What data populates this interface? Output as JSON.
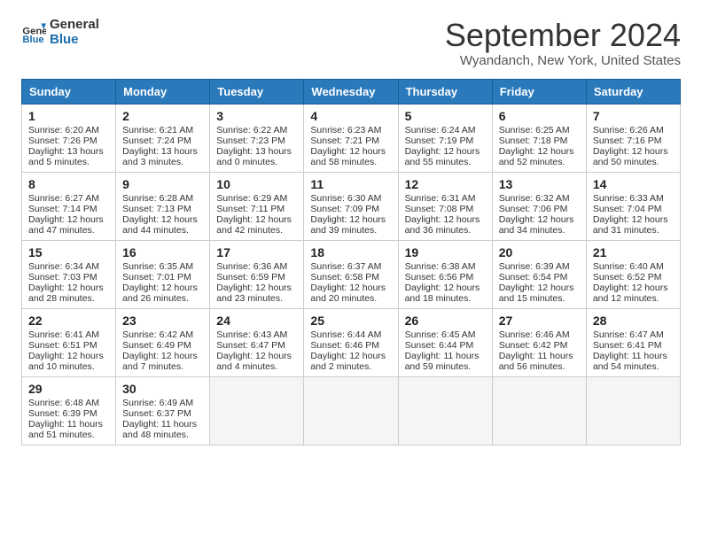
{
  "logo": {
    "line1": "General",
    "line2": "Blue"
  },
  "title": "September 2024",
  "location": "Wyandanch, New York, United States",
  "days_of_week": [
    "Sunday",
    "Monday",
    "Tuesday",
    "Wednesday",
    "Thursday",
    "Friday",
    "Saturday"
  ],
  "weeks": [
    [
      {
        "day": 1,
        "sunrise": "6:20 AM",
        "sunset": "7:26 PM",
        "daylight": "13 hours and 5 minutes."
      },
      {
        "day": 2,
        "sunrise": "6:21 AM",
        "sunset": "7:24 PM",
        "daylight": "13 hours and 3 minutes."
      },
      {
        "day": 3,
        "sunrise": "6:22 AM",
        "sunset": "7:23 PM",
        "daylight": "13 hours and 0 minutes."
      },
      {
        "day": 4,
        "sunrise": "6:23 AM",
        "sunset": "7:21 PM",
        "daylight": "12 hours and 58 minutes."
      },
      {
        "day": 5,
        "sunrise": "6:24 AM",
        "sunset": "7:19 PM",
        "daylight": "12 hours and 55 minutes."
      },
      {
        "day": 6,
        "sunrise": "6:25 AM",
        "sunset": "7:18 PM",
        "daylight": "12 hours and 52 minutes."
      },
      {
        "day": 7,
        "sunrise": "6:26 AM",
        "sunset": "7:16 PM",
        "daylight": "12 hours and 50 minutes."
      }
    ],
    [
      {
        "day": 8,
        "sunrise": "6:27 AM",
        "sunset": "7:14 PM",
        "daylight": "12 hours and 47 minutes."
      },
      {
        "day": 9,
        "sunrise": "6:28 AM",
        "sunset": "7:13 PM",
        "daylight": "12 hours and 44 minutes."
      },
      {
        "day": 10,
        "sunrise": "6:29 AM",
        "sunset": "7:11 PM",
        "daylight": "12 hours and 42 minutes."
      },
      {
        "day": 11,
        "sunrise": "6:30 AM",
        "sunset": "7:09 PM",
        "daylight": "12 hours and 39 minutes."
      },
      {
        "day": 12,
        "sunrise": "6:31 AM",
        "sunset": "7:08 PM",
        "daylight": "12 hours and 36 minutes."
      },
      {
        "day": 13,
        "sunrise": "6:32 AM",
        "sunset": "7:06 PM",
        "daylight": "12 hours and 34 minutes."
      },
      {
        "day": 14,
        "sunrise": "6:33 AM",
        "sunset": "7:04 PM",
        "daylight": "12 hours and 31 minutes."
      }
    ],
    [
      {
        "day": 15,
        "sunrise": "6:34 AM",
        "sunset": "7:03 PM",
        "daylight": "12 hours and 28 minutes."
      },
      {
        "day": 16,
        "sunrise": "6:35 AM",
        "sunset": "7:01 PM",
        "daylight": "12 hours and 26 minutes."
      },
      {
        "day": 17,
        "sunrise": "6:36 AM",
        "sunset": "6:59 PM",
        "daylight": "12 hours and 23 minutes."
      },
      {
        "day": 18,
        "sunrise": "6:37 AM",
        "sunset": "6:58 PM",
        "daylight": "12 hours and 20 minutes."
      },
      {
        "day": 19,
        "sunrise": "6:38 AM",
        "sunset": "6:56 PM",
        "daylight": "12 hours and 18 minutes."
      },
      {
        "day": 20,
        "sunrise": "6:39 AM",
        "sunset": "6:54 PM",
        "daylight": "12 hours and 15 minutes."
      },
      {
        "day": 21,
        "sunrise": "6:40 AM",
        "sunset": "6:52 PM",
        "daylight": "12 hours and 12 minutes."
      }
    ],
    [
      {
        "day": 22,
        "sunrise": "6:41 AM",
        "sunset": "6:51 PM",
        "daylight": "12 hours and 10 minutes."
      },
      {
        "day": 23,
        "sunrise": "6:42 AM",
        "sunset": "6:49 PM",
        "daylight": "12 hours and 7 minutes."
      },
      {
        "day": 24,
        "sunrise": "6:43 AM",
        "sunset": "6:47 PM",
        "daylight": "12 hours and 4 minutes."
      },
      {
        "day": 25,
        "sunrise": "6:44 AM",
        "sunset": "6:46 PM",
        "daylight": "12 hours and 2 minutes."
      },
      {
        "day": 26,
        "sunrise": "6:45 AM",
        "sunset": "6:44 PM",
        "daylight": "11 hours and 59 minutes."
      },
      {
        "day": 27,
        "sunrise": "6:46 AM",
        "sunset": "6:42 PM",
        "daylight": "11 hours and 56 minutes."
      },
      {
        "day": 28,
        "sunrise": "6:47 AM",
        "sunset": "6:41 PM",
        "daylight": "11 hours and 54 minutes."
      }
    ],
    [
      {
        "day": 29,
        "sunrise": "6:48 AM",
        "sunset": "6:39 PM",
        "daylight": "11 hours and 51 minutes."
      },
      {
        "day": 30,
        "sunrise": "6:49 AM",
        "sunset": "6:37 PM",
        "daylight": "11 hours and 48 minutes."
      },
      null,
      null,
      null,
      null,
      null
    ]
  ]
}
